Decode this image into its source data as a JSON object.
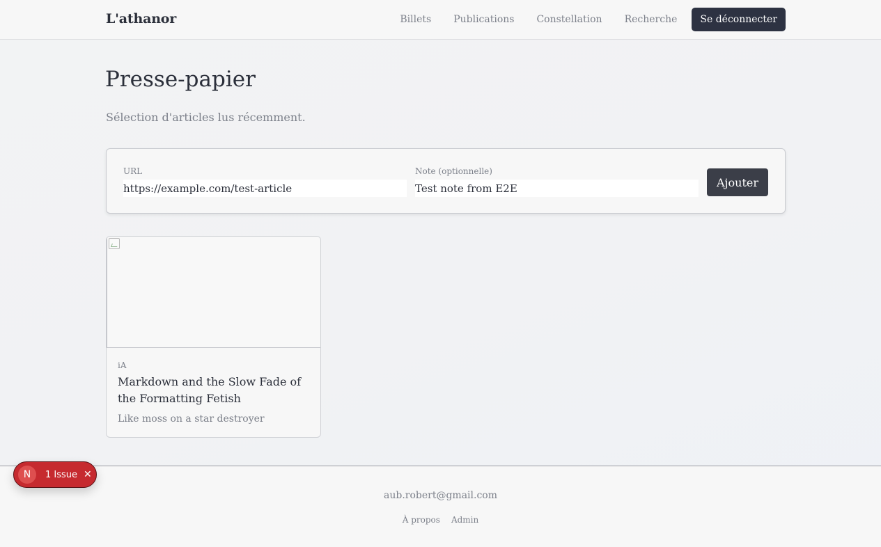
{
  "header": {
    "brand": "L'athanor",
    "nav": {
      "billets": "Billets",
      "publications": "Publications",
      "constellation": "Constellation",
      "recherche": "Recherche"
    },
    "logout": "Se déconnecter"
  },
  "page": {
    "title": "Presse-papier",
    "subtitle": "Sélection d'articles lus récemment."
  },
  "form": {
    "url_label": "URL",
    "url_value": "https://example.com/test-article",
    "note_label": "Note (optionnelle)",
    "note_value": "Test note from E2E",
    "submit": "Ajouter"
  },
  "cards": [
    {
      "source": "iA",
      "title": "Markdown and the Slow Fade of the Formatting Fetish",
      "note": "Like moss on a star destroyer"
    }
  ],
  "footer": {
    "email": "aub.robert@gmail.com",
    "links": {
      "about": "À propos",
      "admin": "Admin"
    }
  },
  "dev_overlay": {
    "logo": "N",
    "issues": "1 Issue",
    "close": "✕"
  },
  "colors": {
    "primary_button": "#2d3242",
    "muted_text": "#7c808a",
    "issue_badge": "#c62a2f"
  },
  "icons": {
    "card_image": "broken-image-icon",
    "overlay_logo": "nextjs-icon",
    "overlay_close": "close-icon"
  }
}
